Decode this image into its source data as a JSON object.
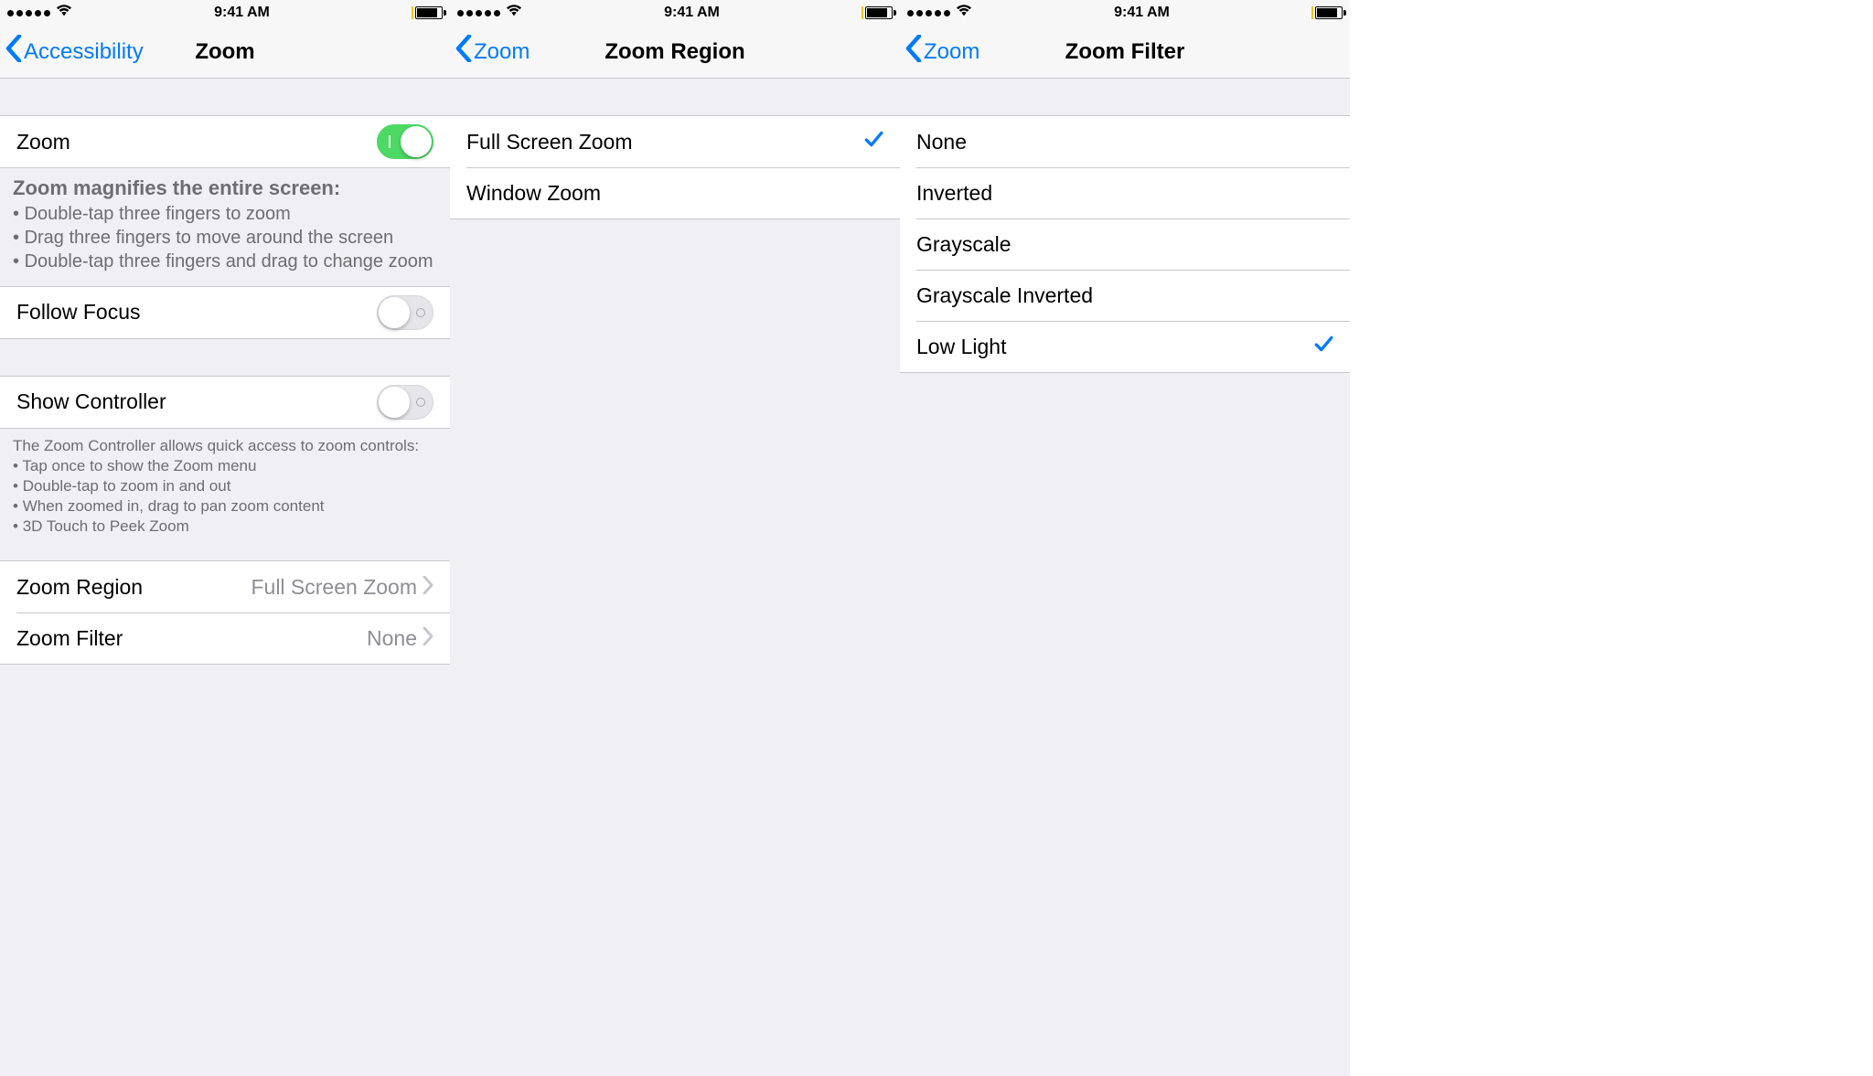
{
  "status": {
    "time": "9:41 AM"
  },
  "screen1": {
    "back": "Accessibility",
    "title": "Zoom",
    "zoom_label": "Zoom",
    "zoom_on": true,
    "zoom_footer_header": "Zoom magnifies the entire screen:",
    "zoom_footer_items": [
      "Double-tap three fingers to zoom",
      "Drag three fingers to move around the screen",
      "Double-tap three fingers and drag to change zoom"
    ],
    "follow_focus_label": "Follow Focus",
    "follow_focus_on": false,
    "show_controller_label": "Show Controller",
    "show_controller_on": false,
    "controller_footer_header": "The Zoom Controller allows quick access to zoom controls:",
    "controller_footer_items": [
      "Tap once to show the Zoom menu",
      "Double-tap to zoom in and out",
      "When zoomed in, drag to pan zoom content",
      "3D Touch to Peek Zoom"
    ],
    "zoom_region_label": "Zoom Region",
    "zoom_region_value": "Full Screen Zoom",
    "zoom_filter_label": "Zoom Filter",
    "zoom_filter_value": "None"
  },
  "screen2": {
    "back": "Zoom",
    "title": "Zoom Region",
    "options": [
      {
        "label": "Full Screen Zoom",
        "selected": true
      },
      {
        "label": "Window Zoom",
        "selected": false
      }
    ]
  },
  "screen3": {
    "back": "Zoom",
    "title": "Zoom Filter",
    "options": [
      {
        "label": "None",
        "selected": false
      },
      {
        "label": "Inverted",
        "selected": false
      },
      {
        "label": "Grayscale",
        "selected": false
      },
      {
        "label": "Grayscale Inverted",
        "selected": false
      },
      {
        "label": "Low Light",
        "selected": true
      }
    ]
  }
}
